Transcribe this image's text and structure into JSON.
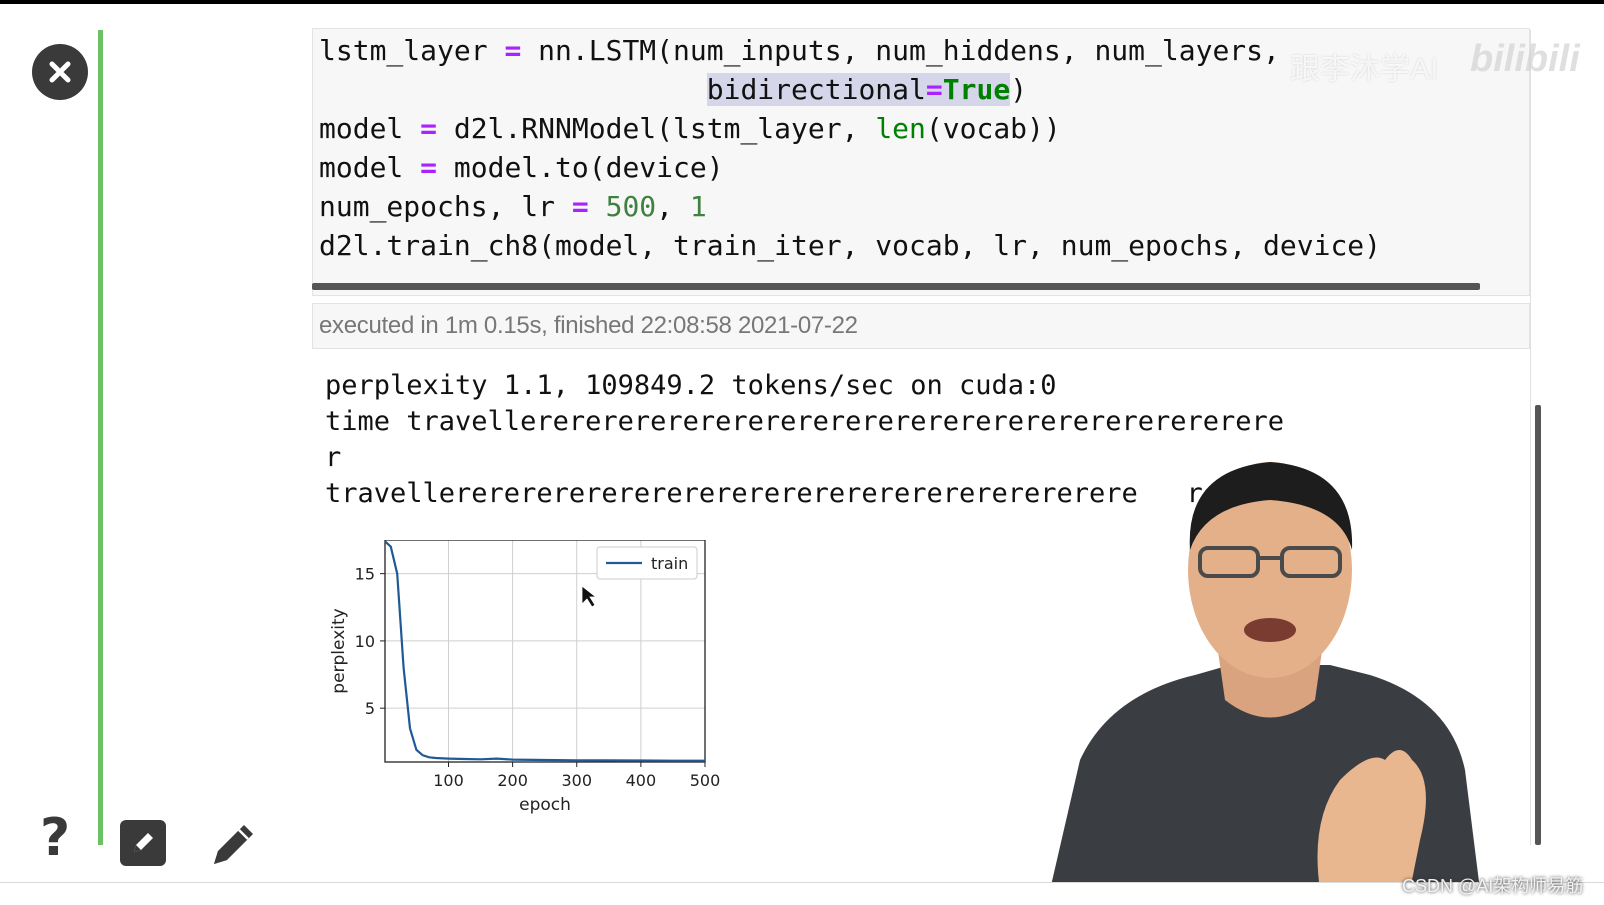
{
  "toolbar": {
    "close_icon": "close-icon",
    "help_label": "?",
    "edit_icon": "edit-icon",
    "pencil_icon": "pencil-icon"
  },
  "code_cell": {
    "lines": [
      [
        "lstm_layer ",
        "=",
        " nn.LSTM(num_inputs, num_hiddens, num_layers,"
      ],
      [
        "                       ",
        "bidirectional",
        "=",
        "True",
        ")"
      ],
      [
        "model ",
        "=",
        " d2l.RNNModel(lstm_layer, ",
        "len",
        "(vocab))"
      ],
      [
        "model ",
        "=",
        " model.to(device)"
      ],
      [
        "num_epochs, lr ",
        "=",
        " ",
        "500",
        ", ",
        "1"
      ],
      [
        "d2l.train_ch8(model, train_iter, vocab, lr, num_epochs, device)"
      ]
    ]
  },
  "execution": {
    "info": "executed in 1m 0.15s, finished 22:08:58 2021-07-22"
  },
  "output": {
    "line1": "perplexity 1.1, 109849.2 tokens/sec on cuda:0",
    "line2": "time travellererererererererererererererererererererererere",
    "line3": "r",
    "line4": "travellererererererererererererererererererererere   rerer"
  },
  "chart_data": {
    "type": "line",
    "xlabel": "epoch",
    "ylabel": "perplexity",
    "xlim": [
      1,
      500
    ],
    "ylim": [
      1,
      17.5
    ],
    "xticks": [
      100,
      200,
      300,
      400,
      500
    ],
    "yticks": [
      5,
      10,
      15
    ],
    "grid": true,
    "legend": "top-right",
    "series": [
      {
        "name": "train",
        "color": "#1f5a96",
        "x": [
          1,
          10,
          20,
          30,
          40,
          50,
          60,
          70,
          80,
          100,
          125,
          150,
          175,
          200,
          250,
          300,
          350,
          400,
          450,
          500
        ],
        "y": [
          17.4,
          17.0,
          15.0,
          8.0,
          3.5,
          1.9,
          1.5,
          1.35,
          1.3,
          1.25,
          1.22,
          1.2,
          1.25,
          1.18,
          1.15,
          1.13,
          1.12,
          1.11,
          1.1,
          1.1
        ]
      }
    ]
  },
  "watermark": {
    "text": "跟李沐学AI",
    "logo": "bilibili"
  },
  "credit": "CSDN @AI架构师易筋",
  "colors": {
    "green_bar": "#6cc164",
    "operator": "#aa22ff",
    "keyword": "#008000",
    "series_line": "#1f5a96"
  }
}
